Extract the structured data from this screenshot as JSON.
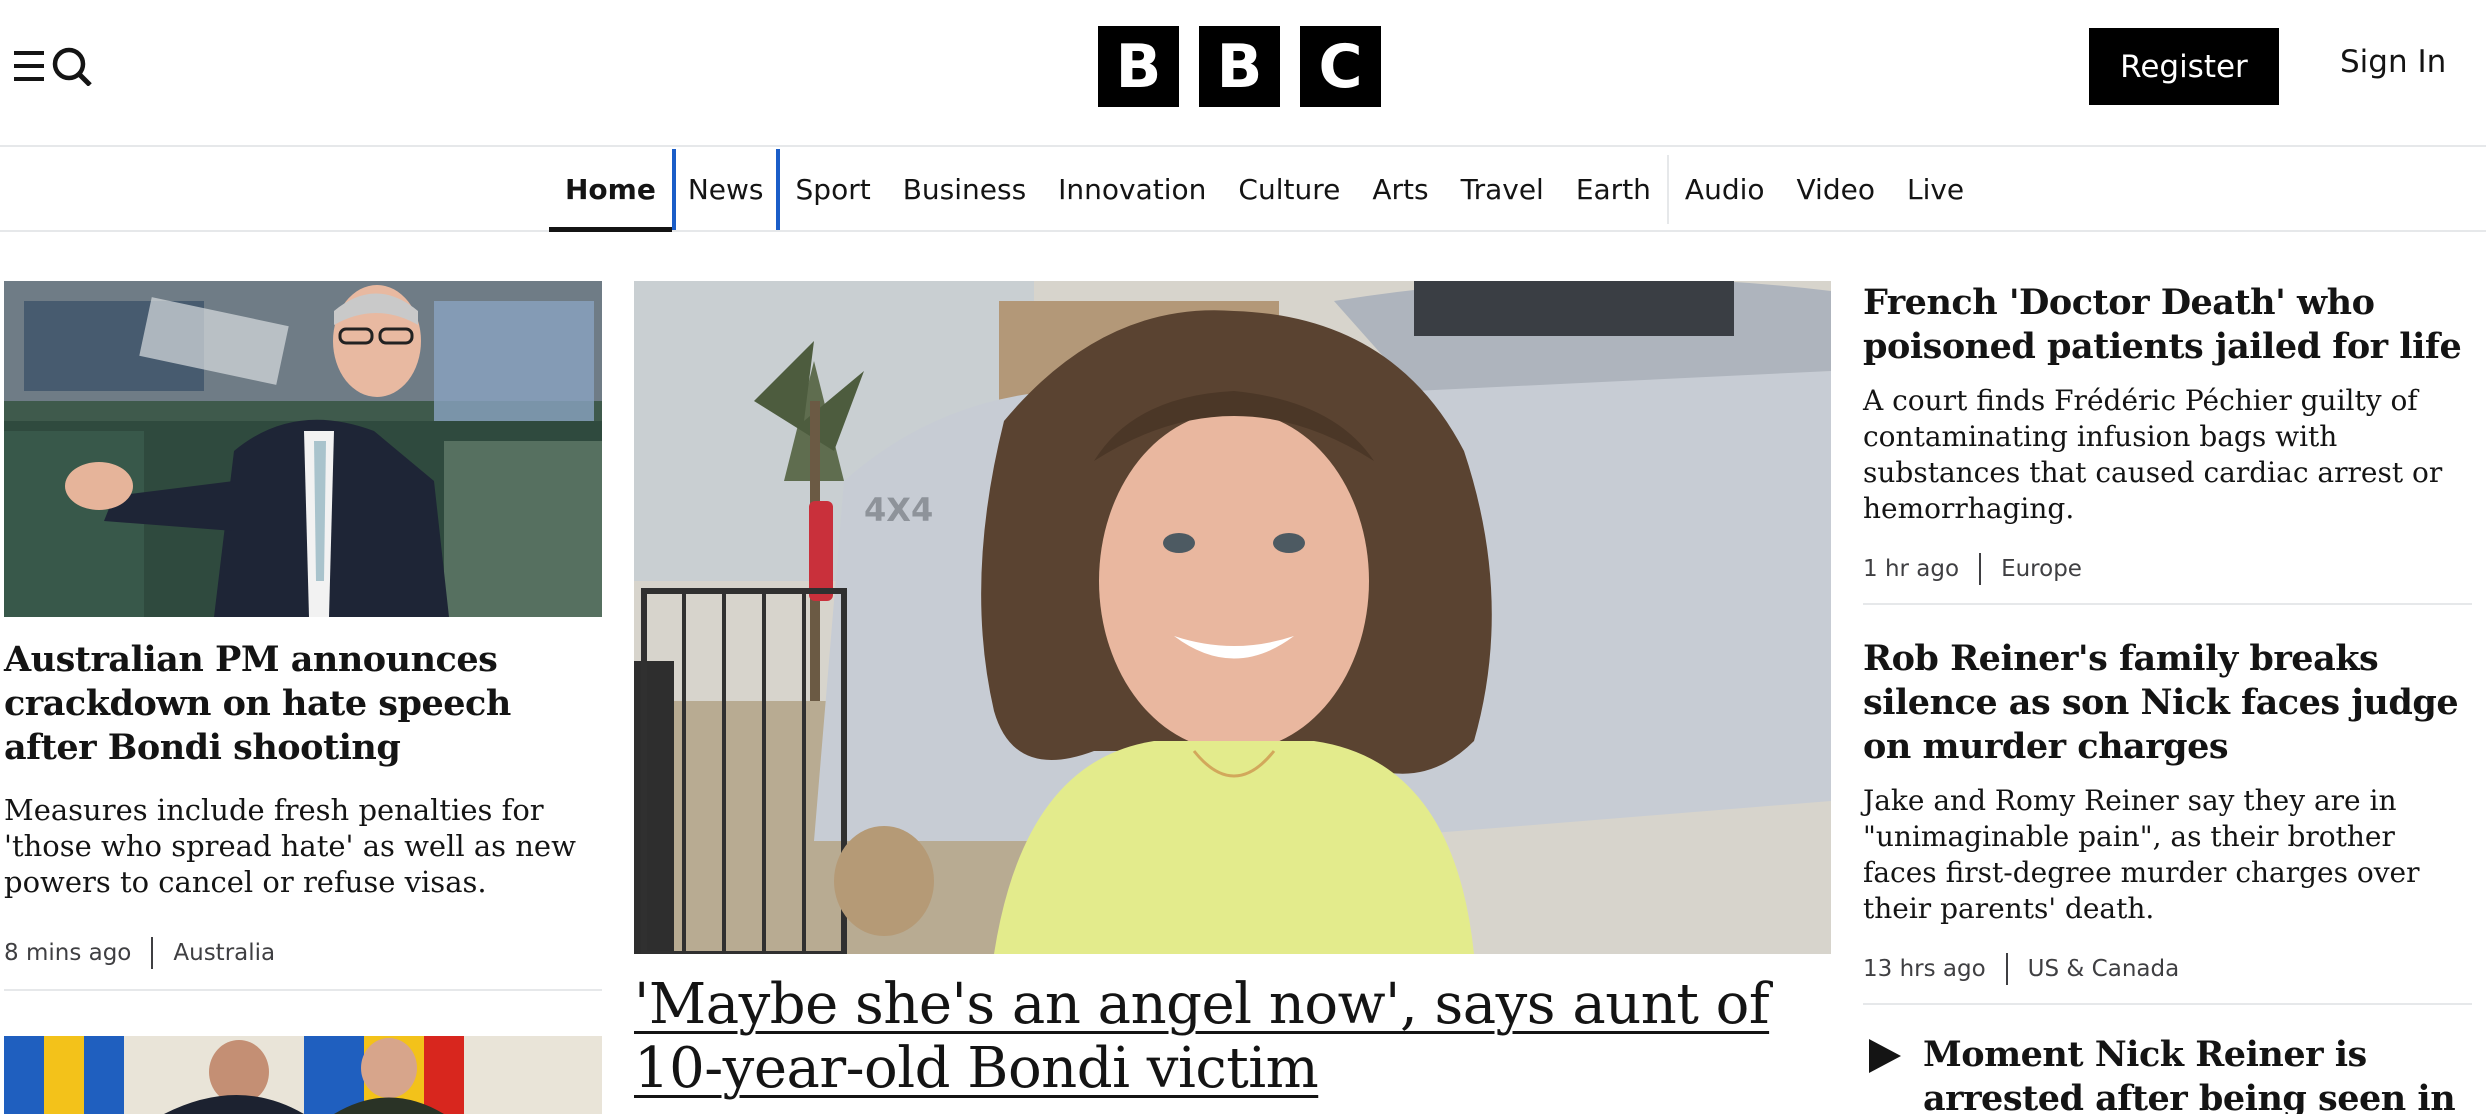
{
  "header": {
    "logo_letters": [
      "B",
      "B",
      "C"
    ],
    "register_label": "Register",
    "signin_label": "Sign In"
  },
  "nav": {
    "items": [
      "Home",
      "News",
      "Sport",
      "Business",
      "Innovation",
      "Culture",
      "Arts",
      "Travel",
      "Earth",
      "Audio",
      "Video",
      "Live"
    ],
    "active": "Home",
    "focused": "News"
  },
  "left_story": {
    "headline": "Australian PM announces crackdown on hate speech after Bondi shooting",
    "summary": "Measures include fresh penalties for 'those who spread hate' as well as new powers to cancel or refuse visas.",
    "time": "8 mins ago",
    "section": "Australia"
  },
  "center_story": {
    "headline": "'Maybe she's an angel now', says aunt of 10-year-old Bondi victim"
  },
  "right_stories": [
    {
      "headline": "French 'Doctor Death' who poisoned patients jailed for life",
      "summary": "A court finds Frédéric Péchier guilty of contaminating infusion bags with substances that caused cardiac arrest or hemorrhaging.",
      "time": "1 hr ago",
      "section": "Europe"
    },
    {
      "headline": "Rob Reiner's family breaks silence as son Nick faces judge on murder charges",
      "summary": "Jake and Romy Reiner say they are in \"unimaginable pain\", as their brother faces first-degree murder charges over their parents' death.",
      "time": "13 hrs ago",
      "section": "US & Canada"
    },
    {
      "headline": "Moment Nick Reiner is arrested after being seen in convenience",
      "icon": "play-icon"
    }
  ],
  "colors": {
    "brand_black": "#000000",
    "focus_blue": "#1a5dc8",
    "rule_grey": "#e6e8ea"
  }
}
